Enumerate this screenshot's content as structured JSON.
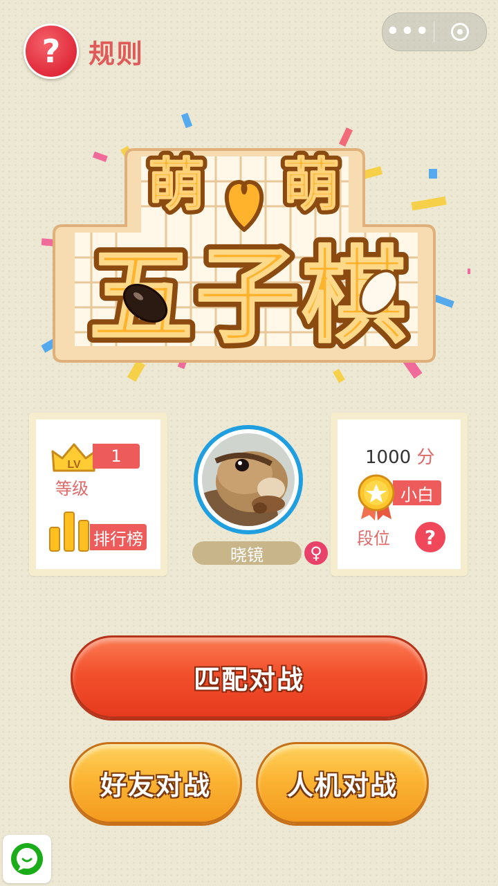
{
  "header": {
    "rules_label": "规则",
    "rules_icon_glyph": "?",
    "menu_dots": "•••"
  },
  "logo": {
    "line1_left": "萌",
    "line1_right": "萌",
    "line2": "五子棋",
    "heart_icon": "heart-icon"
  },
  "left_card": {
    "lv_text": "LV",
    "level": "1",
    "level_label": "等级",
    "rank_label": "排行榜"
  },
  "profile": {
    "name": "晓镜",
    "gender_symbol": "♀"
  },
  "right_card": {
    "score_value": "1000",
    "score_unit": "分",
    "tier": "小白",
    "tier_label": "段位",
    "help_glyph": "?"
  },
  "buttons": {
    "match": "匹配对战",
    "friend": "好友对战",
    "ai": "人机对战"
  },
  "colors": {
    "background": "#ece8d3",
    "accent_red": "#ee5b5b",
    "match_button": "#f2512d",
    "orange_button": "#fbb434",
    "avatar_ring": "#1f9fe0"
  }
}
